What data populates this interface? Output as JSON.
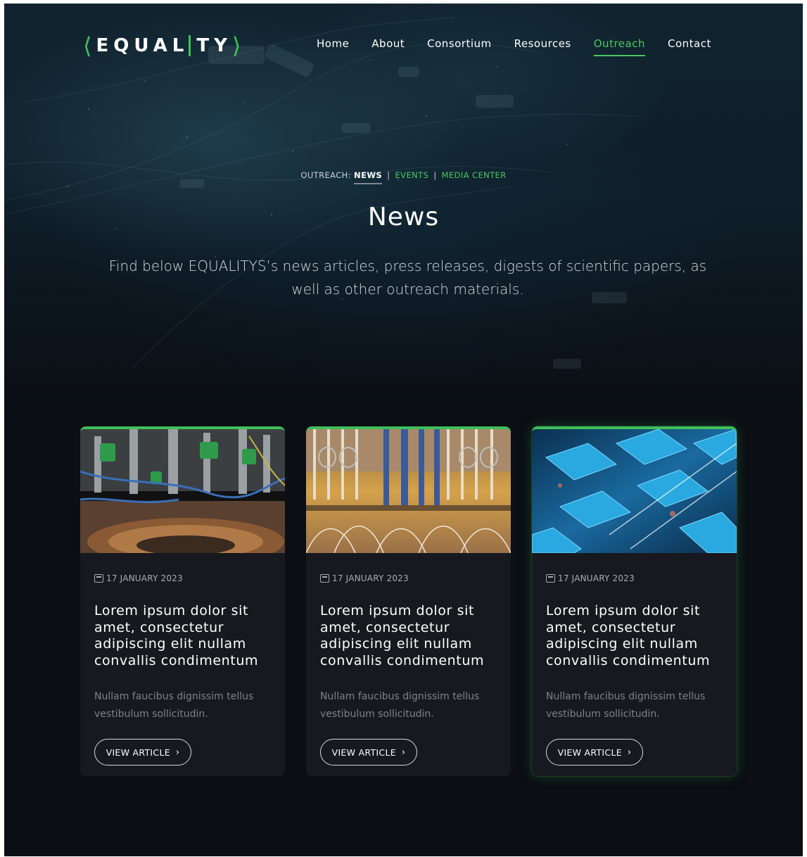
{
  "brand": {
    "logo_left": "EQUAL",
    "logo_right": "TY",
    "accent_color": "#4cc85e"
  },
  "nav": {
    "items": [
      {
        "label": "Home",
        "active": false
      },
      {
        "label": "About",
        "active": false
      },
      {
        "label": "Consortium",
        "active": false
      },
      {
        "label": "Resources",
        "active": false
      },
      {
        "label": "Outreach",
        "active": true
      },
      {
        "label": "Contact",
        "active": false
      }
    ]
  },
  "hero": {
    "section_prefix": "OUTREACH:",
    "sub_current": "NEWS",
    "sub_events": "EVENTS",
    "sub_media": "MEDIA CENTER",
    "separator": "|",
    "title": "News",
    "description": "Find below EQUALITYS’s news articles, press releases, digests of scientific papers, as well as other outreach materials."
  },
  "cards": [
    {
      "date": "17 JANUARY 2023",
      "title": "Lorem ipsum dolor sit amet, consectetur adipiscing elit nullam convallis condimentum",
      "excerpt": "Nullam faucibus dignissim tellus vestibulum sollicitudin.",
      "button": "VIEW ARTICLE",
      "image": "quantum-optics-lab-photo"
    },
    {
      "date": "17 JANUARY 2023",
      "title": "Lorem ipsum dolor sit amet, consectetur adipiscing elit nullam convallis condimentum",
      "excerpt": "Nullam faucibus dignissim tellus vestibulum sollicitudin.",
      "button": "VIEW ARTICLE",
      "image": "quantum-computer-chandelier-photo"
    },
    {
      "date": "17 JANUARY 2023",
      "title": "Lorem ipsum dolor sit amet, consectetur adipiscing elit nullam convallis condimentum",
      "excerpt": "Nullam faucibus dignissim tellus vestibulum sollicitudin.",
      "button": "VIEW ARTICLE",
      "image": "glowing-chip-array-render"
    }
  ]
}
